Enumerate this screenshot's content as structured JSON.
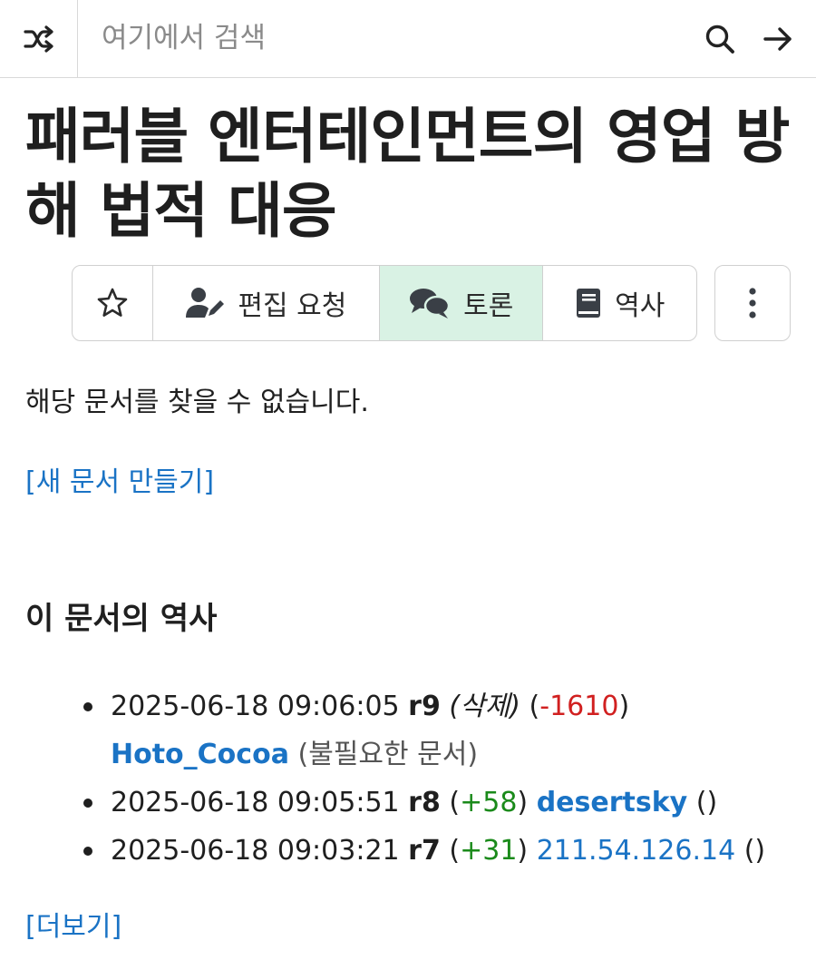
{
  "search": {
    "placeholder": "여기에서 검색"
  },
  "page": {
    "title": "패러블 엔터테인먼트의 영업 방해 법적 대응",
    "not_found_text": "해당 문서를 찾을 수 없습니다.",
    "create_link": "[새 문서 만들기]"
  },
  "toolbar": {
    "edit_request_label": "편집 요청",
    "discussion_label": "토론",
    "history_label": "역사",
    "discussion_active_color": "#d9f2e4"
  },
  "icons": {
    "shuffle": "shuffle-icon",
    "search": "search-icon",
    "go": "arrow-right-icon",
    "star": "star-icon",
    "edit_request": "user-pen-icon",
    "discussion": "comments-icon",
    "history": "book-icon",
    "more": "vertical-ellipsis-icon"
  },
  "history": {
    "heading": "이 문서의 역사",
    "open_paren": "(",
    "close_paren": ")",
    "empty_note": "()",
    "items": [
      {
        "datetime": "2025-06-18 09:06:05",
        "revision": "r9",
        "action": "(삭제)",
        "change": "-1610",
        "user": "Hoto_Cocoa",
        "note": "(불필요한 문서)"
      },
      {
        "datetime": "2025-06-18 09:05:51",
        "revision": "r8",
        "change": "+58",
        "user": "desertsky"
      },
      {
        "datetime": "2025-06-18 09:03:21",
        "revision": "r7",
        "change": "+31",
        "user": "211.54.126.14"
      }
    ],
    "more_link": "[더보기]"
  },
  "colors": {
    "link": "#1a73c5",
    "minus": "#d12020",
    "plus": "#1a8a1a"
  }
}
